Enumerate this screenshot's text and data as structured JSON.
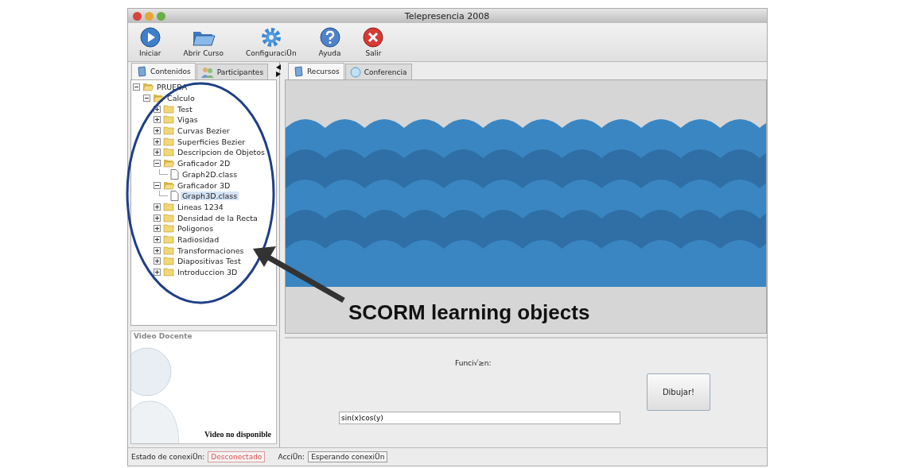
{
  "window": {
    "title": "Telepresencia 2008"
  },
  "toolbar": [
    {
      "label": "Iniciar",
      "kind": "play"
    },
    {
      "label": "Abrir Curso",
      "kind": "folder"
    },
    {
      "label": "ConfiguraciÜn",
      "kind": "gear"
    },
    {
      "label": "Ayuda",
      "kind": "help"
    },
    {
      "label": "Salir",
      "kind": "exit"
    }
  ],
  "left_tabs": [
    {
      "label": "Contenidos",
      "selected": true,
      "kind": "book"
    },
    {
      "label": "Participantes",
      "selected": false,
      "kind": "people"
    }
  ],
  "tree": [
    {
      "label": "PRUEBA",
      "kind": "folder",
      "expanded": true,
      "selected": false,
      "children": [
        {
          "label": "Calculo",
          "kind": "folder",
          "expanded": true,
          "selected": false,
          "children": [
            {
              "label": "Test",
              "kind": "folder",
              "expanded": false,
              "selected": false
            },
            {
              "label": "Vigas",
              "kind": "folder",
              "expanded": false,
              "selected": false
            },
            {
              "label": "Curvas Bezier",
              "kind": "folder",
              "expanded": false,
              "selected": false
            },
            {
              "label": "Superficies Bezier",
              "kind": "folder",
              "expanded": false,
              "selected": false
            },
            {
              "label": "Descripcion de Objetos",
              "kind": "folder",
              "expanded": false,
              "selected": false
            },
            {
              "label": "Graficador 2D",
              "kind": "folder",
              "expanded": true,
              "selected": false,
              "children": [
                {
                  "label": "Graph2D.class",
                  "kind": "file",
                  "selected": false
                }
              ]
            },
            {
              "label": "Graficador 3D",
              "kind": "folder",
              "expanded": true,
              "selected": false,
              "children": [
                {
                  "label": "Graph3D.class",
                  "kind": "file",
                  "selected": true
                }
              ]
            },
            {
              "label": "Lineas 1234",
              "kind": "folder",
              "expanded": false,
              "selected": false
            },
            {
              "label": "Densidad de la Recta",
              "kind": "folder",
              "expanded": false,
              "selected": false
            },
            {
              "label": "Poligonos",
              "kind": "folder",
              "expanded": false,
              "selected": false
            },
            {
              "label": "Radiosidad",
              "kind": "folder",
              "expanded": false,
              "selected": false
            },
            {
              "label": "Transformaciones",
              "kind": "folder",
              "expanded": false,
              "selected": false
            },
            {
              "label": "Diapositivas Test",
              "kind": "folder",
              "expanded": false,
              "selected": false
            },
            {
              "label": "Introduccion 3D",
              "kind": "folder",
              "expanded": false,
              "selected": false
            }
          ]
        }
      ]
    }
  ],
  "video_panel": {
    "title": "Video Docente",
    "message": "Video no disponible"
  },
  "right_tabs": [
    {
      "label": "Recursos",
      "selected": true,
      "kind": "book"
    },
    {
      "label": "Conferencia",
      "selected": false,
      "kind": "globe"
    }
  ],
  "form": {
    "label": "Funci√≥n:",
    "value": "sin(x)cos(y)",
    "button": "Dibujar!"
  },
  "status": [
    {
      "label": "Estado de conexiÜn:",
      "value": "Desconectado",
      "kind": "error"
    },
    {
      "label": "AcciÜn:",
      "value": "Esperando conexiÜn",
      "kind": "normal"
    }
  ],
  "annotation": {
    "label": "SCORM learning objects"
  }
}
